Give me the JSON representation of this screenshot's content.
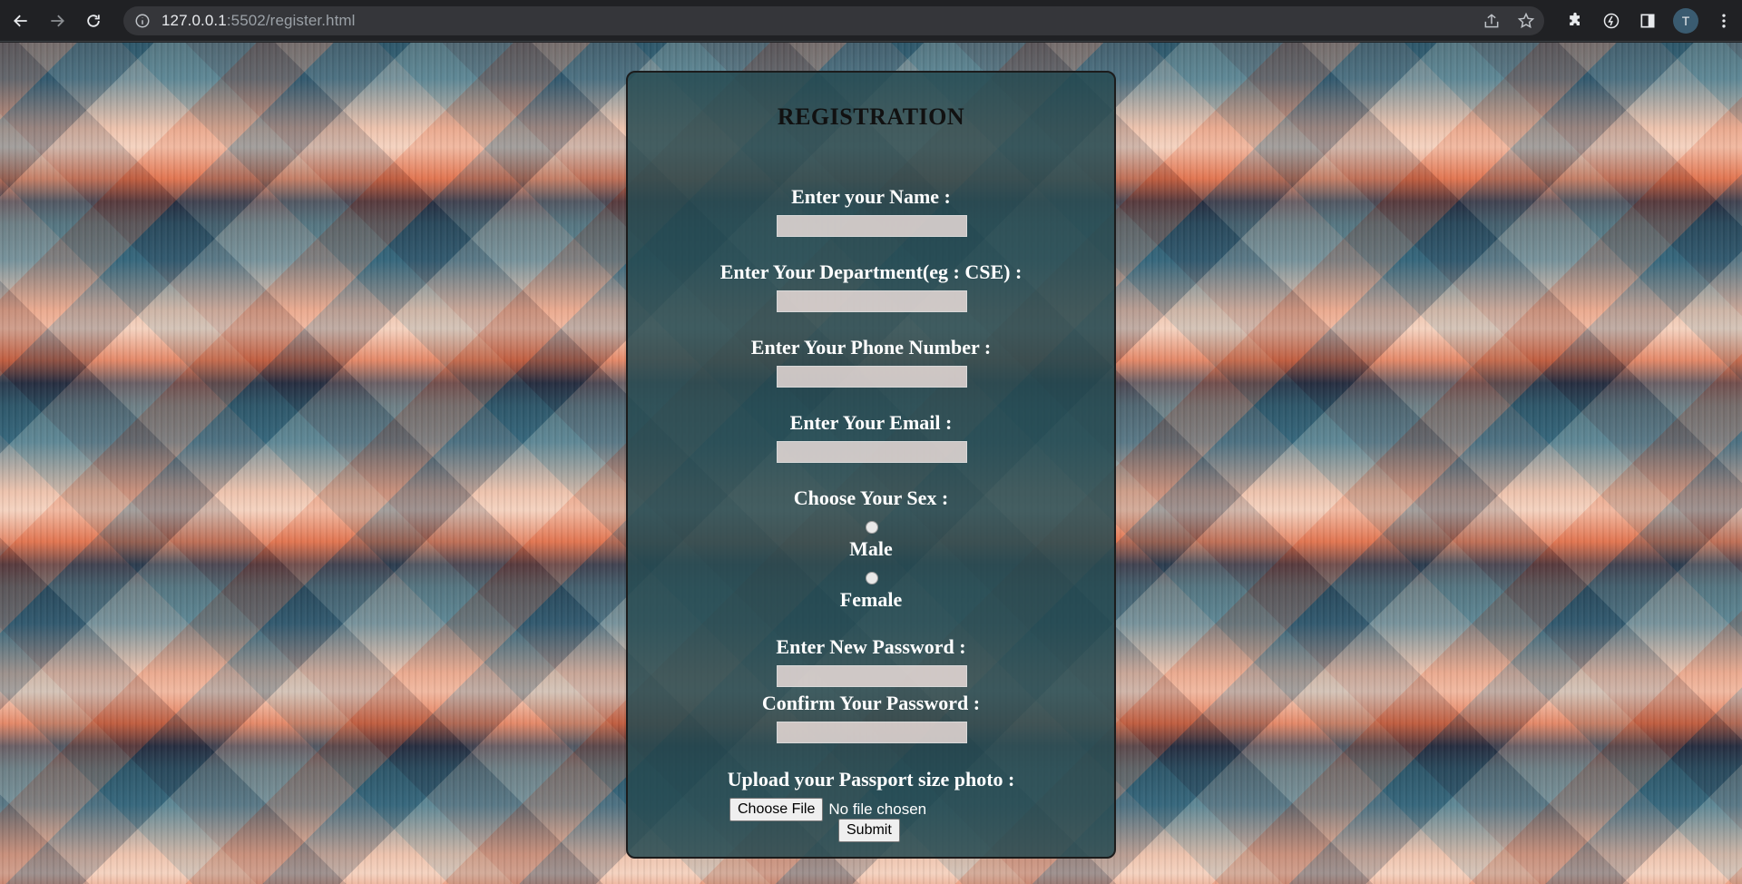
{
  "browser": {
    "url_host": "127.0.0.1",
    "url_path": ":5502/register.html",
    "profile_initial": "T"
  },
  "form": {
    "title": "REGISTRATION",
    "name_label": "Enter your Name :",
    "department_label": "Enter Your Department(eg : CSE) :",
    "phone_label": "Enter Your Phone Number :",
    "email_label": "Enter Your Email :",
    "sex_label": "Choose Your Sex :",
    "sex_options": [
      "Male",
      "Female"
    ],
    "password_label": "Enter New Password :",
    "confirm_password_label": "Confirm Your Password :",
    "photo_label": "Upload your Passport size photo :",
    "choose_file_label": "Choose File",
    "file_status": "No file chosen",
    "submit_label": "Submit"
  },
  "colors": {
    "panel_bg": "#264a52",
    "title_color": "#111111",
    "label_color": "#ffffff"
  }
}
